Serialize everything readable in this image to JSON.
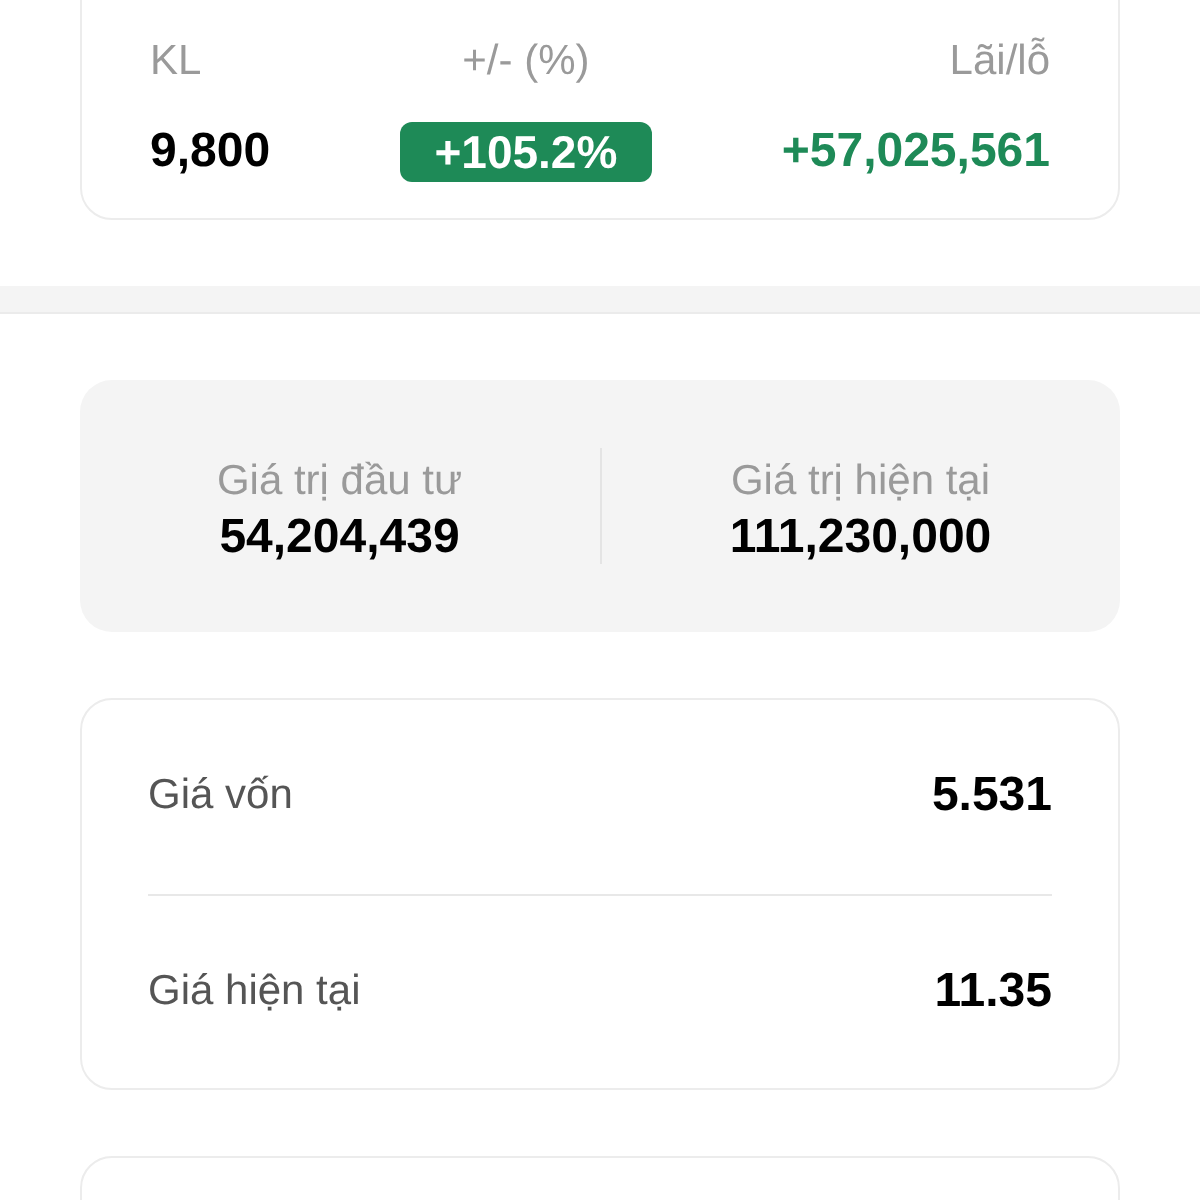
{
  "position": {
    "columns": [
      {
        "kind": "text",
        "label": "KL",
        "value": "9,800"
      },
      {
        "kind": "badge",
        "label": "+/- (%)",
        "value": "+105.2%",
        "positive": true
      },
      {
        "kind": "change",
        "label": "Lãi/lỗ",
        "value": "+57,025,561",
        "positive": true
      }
    ]
  },
  "summary": [
    {
      "label": "Giá trị đầu tư",
      "value": "54,204,439"
    },
    {
      "label": "Giá trị hiện tại",
      "value": "111,230,000"
    }
  ],
  "prices": [
    {
      "label": "Giá vốn",
      "value": "5.531"
    },
    {
      "label": "Giá hiện tại",
      "value": "11.35"
    }
  ]
}
